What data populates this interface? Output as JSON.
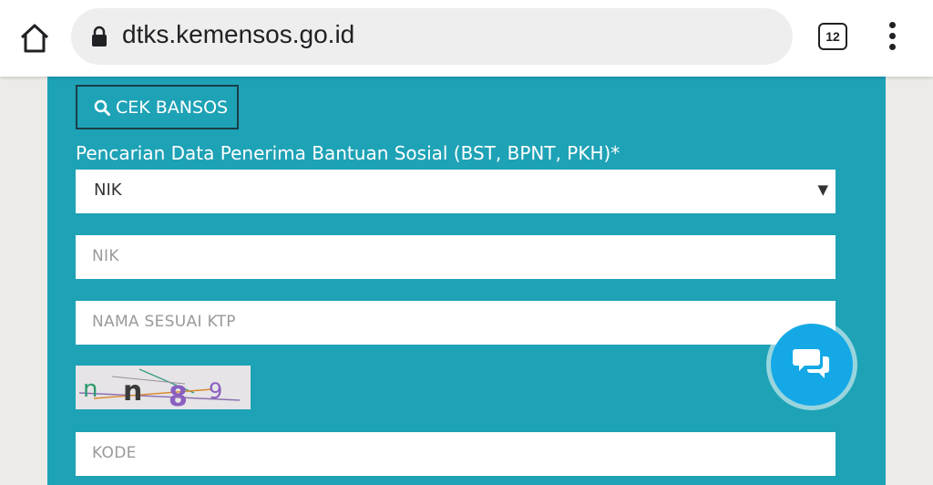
{
  "browser": {
    "url": "dtks.kemensos.go.id",
    "tab_count": "12"
  },
  "form": {
    "cek_bansos_label": "CEK BANSOS",
    "section_label": "Pencarian Data Penerima Bantuan Sosial (BST, BPNT, PKH)*",
    "search_type_value": "NIK",
    "nik_placeholder": "NIK",
    "nama_placeholder": "NAMA SESUAI KTP",
    "captcha_text": "nn89",
    "kode_placeholder": "KODE"
  },
  "colors": {
    "panel": "#1ea2b6",
    "chat_button": "#14a9e6",
    "page_background": "#ecebe8"
  },
  "icons": [
    "home-icon",
    "lock-icon",
    "tab-switcher-icon",
    "more-vert-icon",
    "search-icon",
    "dropdown-caret-icon",
    "chat-icon"
  ]
}
